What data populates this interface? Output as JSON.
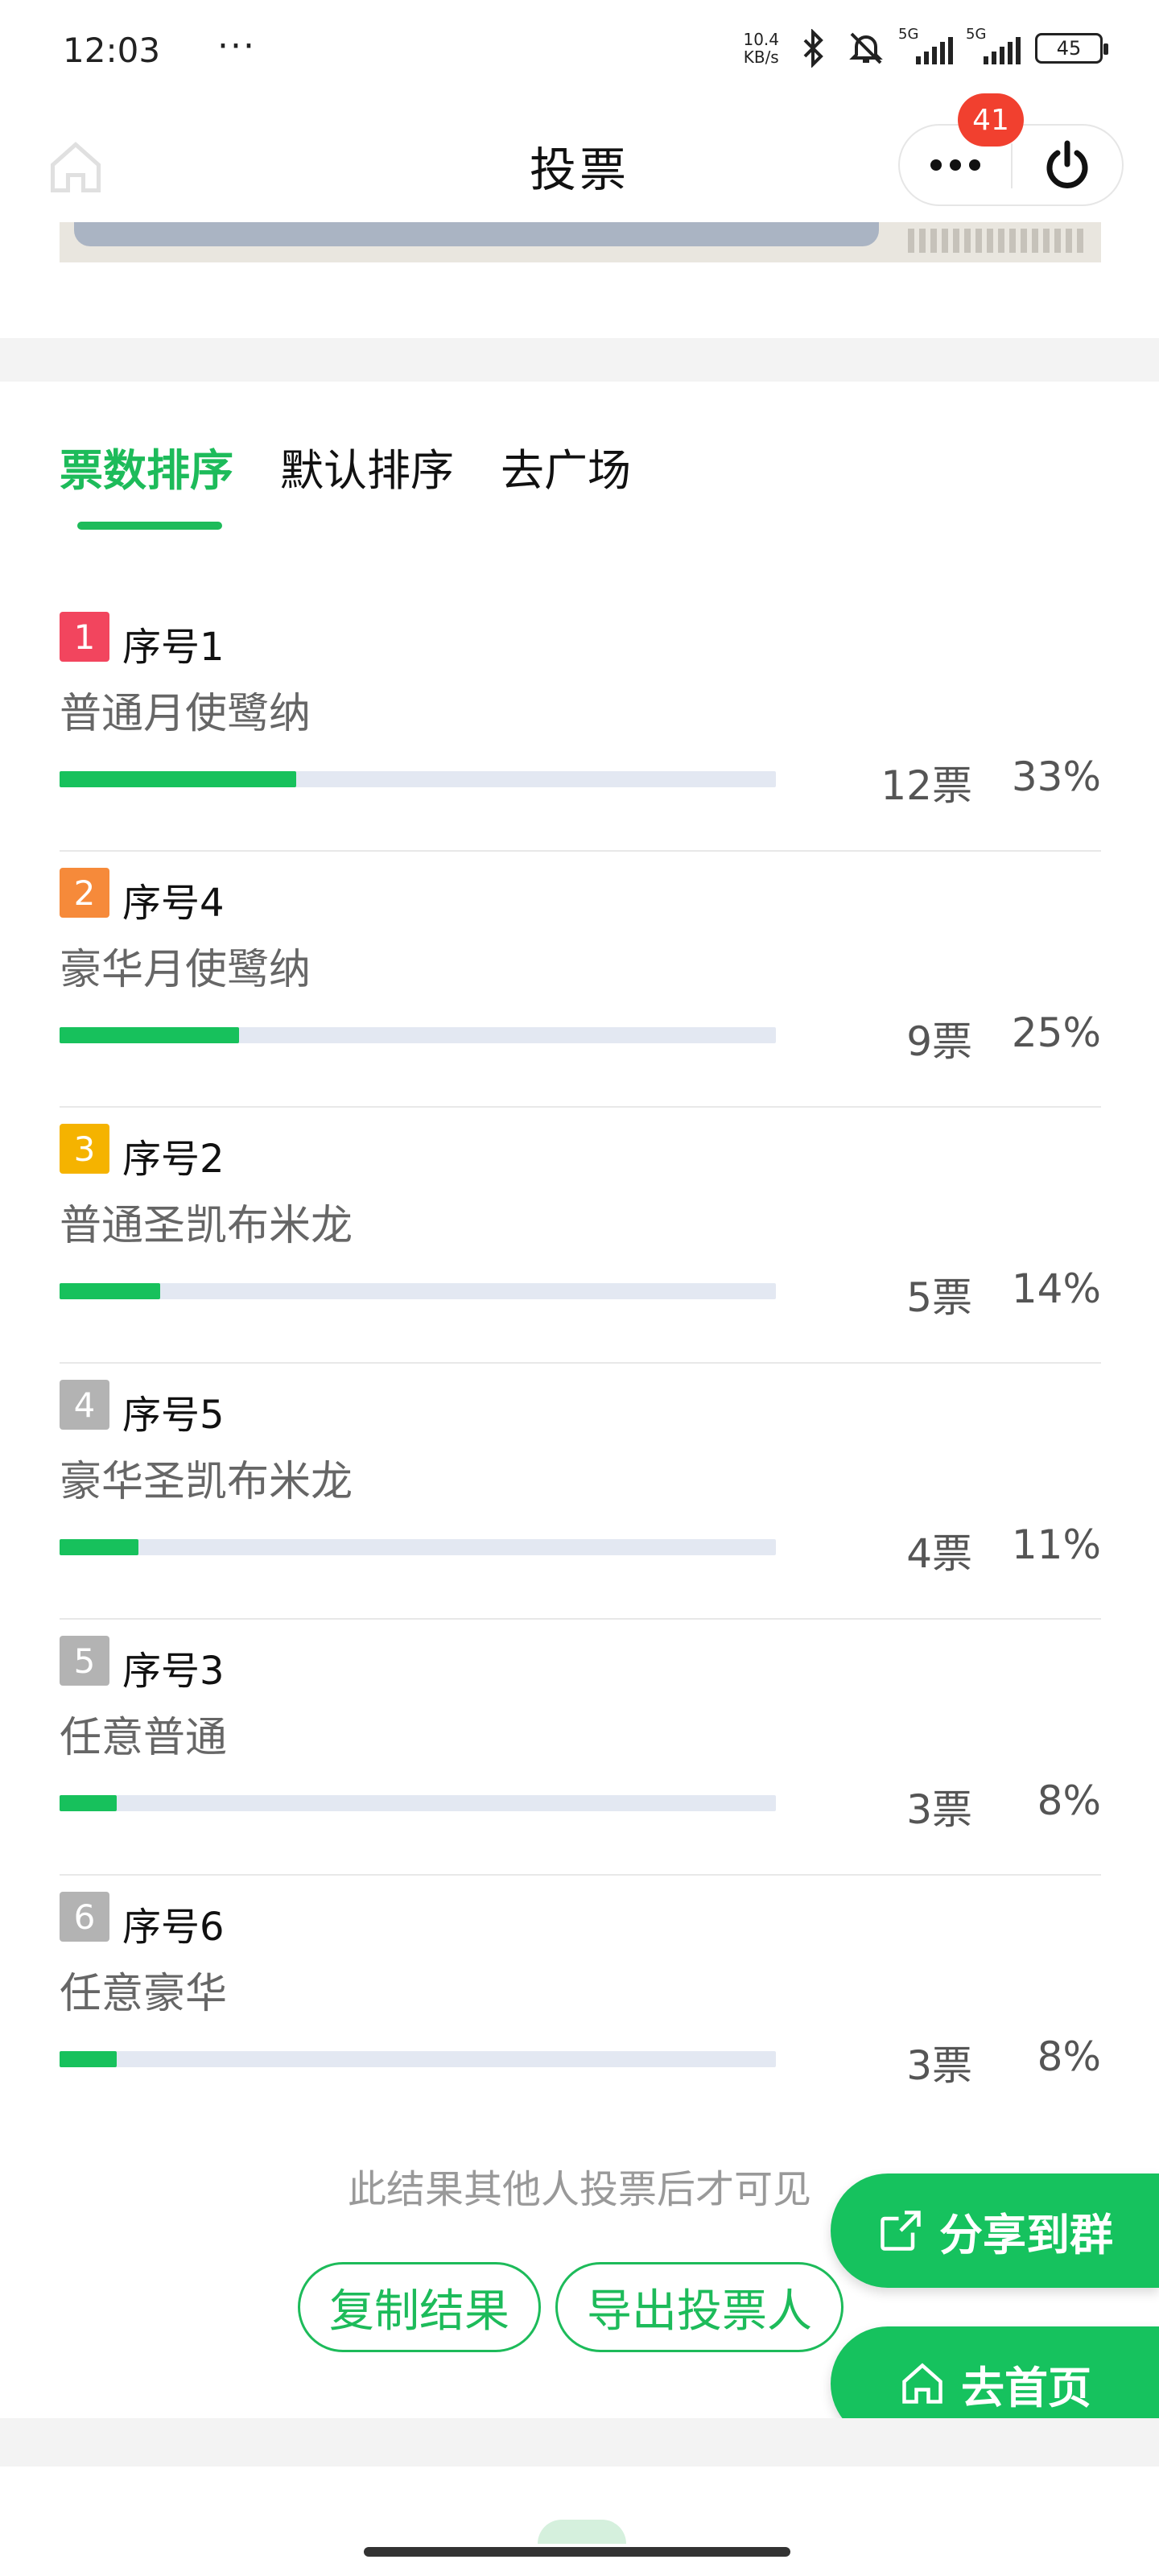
{
  "status_bar": {
    "time": "12:03",
    "dots": "···",
    "net_speed_value": "10.4",
    "net_speed_unit": "KB/s",
    "sim1": "5G",
    "sim2": "5G",
    "battery": "45"
  },
  "header": {
    "title": "投票",
    "badge_count": "41",
    "icons": [
      "home-icon",
      "more-icon",
      "power-icon"
    ]
  },
  "tabs": [
    {
      "label": "票数排序",
      "active": true
    },
    {
      "label": "默认排序",
      "active": false
    },
    {
      "label": "去广场",
      "active": false
    }
  ],
  "results": [
    {
      "rank": "1",
      "rank_color": "#f2455e",
      "seq": "序号1",
      "option": "普通月使鹭纳",
      "votes": "12票",
      "percent": "33%",
      "fraction": 0.33
    },
    {
      "rank": "2",
      "rank_color": "#f68a3a",
      "seq": "序号4",
      "option": "豪华月使鹭纳",
      "votes": "9票",
      "percent": "25%",
      "fraction": 0.25
    },
    {
      "rank": "3",
      "rank_color": "#f5b300",
      "seq": "序号2",
      "option": "普通圣凯布米龙",
      "votes": "5票",
      "percent": "14%",
      "fraction": 0.14
    },
    {
      "rank": "4",
      "rank_color": "#b3b3b3",
      "seq": "序号5",
      "option": "豪华圣凯布米龙",
      "votes": "4票",
      "percent": "11%",
      "fraction": 0.11
    },
    {
      "rank": "5",
      "rank_color": "#b3b3b3",
      "seq": "序号3",
      "option": "任意普通",
      "votes": "3票",
      "percent": "8%",
      "fraction": 0.08
    },
    {
      "rank": "6",
      "rank_color": "#b3b3b3",
      "seq": "序号6",
      "option": "任意豪华",
      "votes": "3票",
      "percent": "8%",
      "fraction": 0.08
    }
  ],
  "notice": "此结果其他人投票后才可见",
  "actions": {
    "copy_label": "复制结果",
    "export_label": "导出投票人"
  },
  "floating": {
    "share_label": "分享到群",
    "home_label": "去首页"
  },
  "colors": {
    "accent": "#1dbb5a",
    "bar_fill": "#17c15c",
    "bar_track": "#e3e8f2",
    "badge": "#f1402f"
  }
}
